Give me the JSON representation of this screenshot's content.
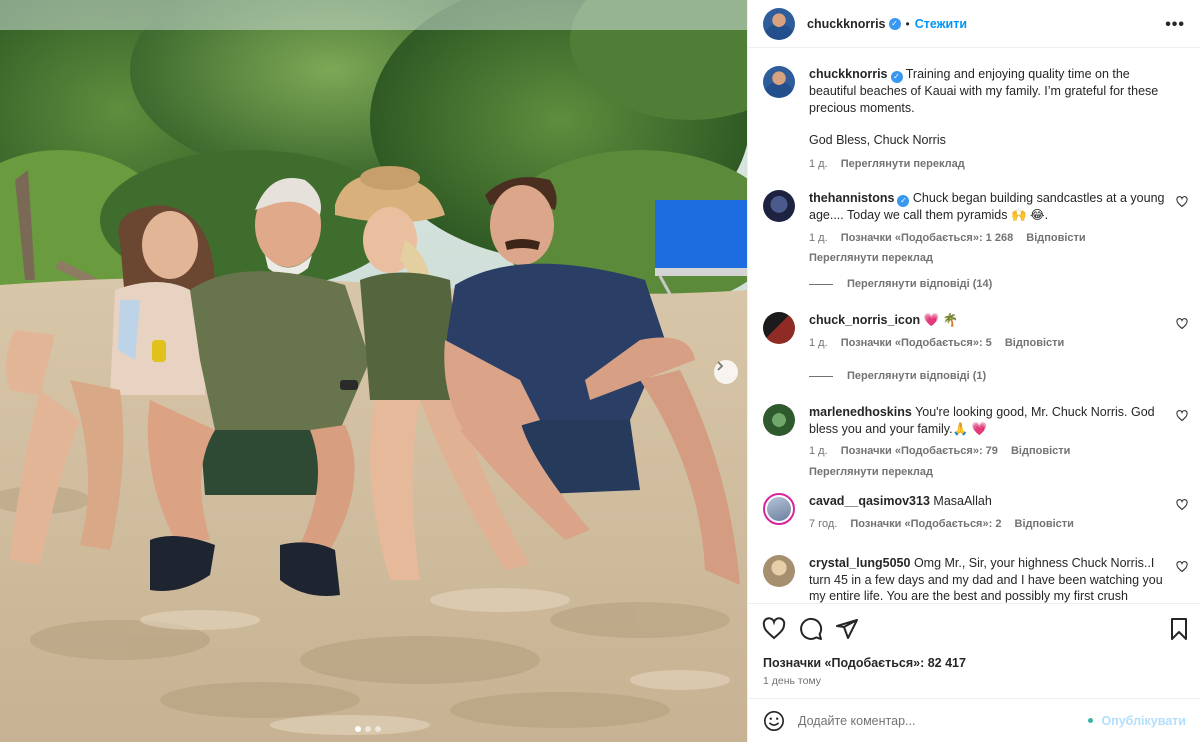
{
  "post": {
    "author": "chuckknorris",
    "follow_label": "Стежити",
    "more_label": "•••",
    "caption": "Training and enjoying quality time on the beautiful beaches of Kauai with my family. I’m grateful for these precious moments.",
    "caption_signoff": "God Bless, Chuck Norris",
    "caption_time": "1 д.",
    "caption_translate": "Переглянути переклад"
  },
  "comments": [
    {
      "user": "thehannistons",
      "verified": true,
      "text": "Chuck began building sandcastles at a young age.... Today we call them pyramids 🙌 😂.",
      "time": "1 д.",
      "likes": "Позначки «Подобається»: 1 268",
      "reply": "Відповісти",
      "translate": "Переглянути переклад",
      "view_replies": "Переглянути відповіді (14)"
    },
    {
      "user": "chuck_norris_icon",
      "text": "💗 🌴",
      "time": "1 д.",
      "likes": "Позначки «Подобається»: 5",
      "reply": "Відповісти",
      "view_replies": "Переглянути відповіді (1)"
    },
    {
      "user": "marlenedhoskins",
      "text": "You're looking good, Mr. Chuck Norris. God bless you and your family.🙏 💗",
      "time": "1 д.",
      "likes": "Позначки «Подобається»: 79",
      "reply": "Відповісти",
      "translate": "Переглянути переклад"
    },
    {
      "user": "cavad__qasimov313",
      "text": "MasaAllah",
      "time": "7 год.",
      "likes": "Позначки «Подобається»: 2",
      "reply": "Відповісти"
    },
    {
      "user": "crystal_lung5050",
      "text": "Omg Mr., Sir, your highness Chuck Norris..I turn 45 in a few days and my dad and I have been watching you my entire life. You are the best and possibly my first crush"
    }
  ],
  "footer": {
    "likes": "Позначки «Подобається»: 82 417",
    "posted": "1 день тому",
    "comment_placeholder": "Додайте коментар...",
    "publish_label": "Опублікувати"
  },
  "icons": [
    "heart-icon",
    "comment-icon",
    "share-icon",
    "bookmark-icon",
    "emoji-icon",
    "more-icon",
    "chevron-right-icon",
    "verified-icon"
  ],
  "colors": {
    "accent": "#0095f6",
    "verified": "#3897f0",
    "publish_disabled": "#b2dffc",
    "heart": "#e0245e"
  },
  "carousel": {
    "total": 3,
    "current": 1
  }
}
